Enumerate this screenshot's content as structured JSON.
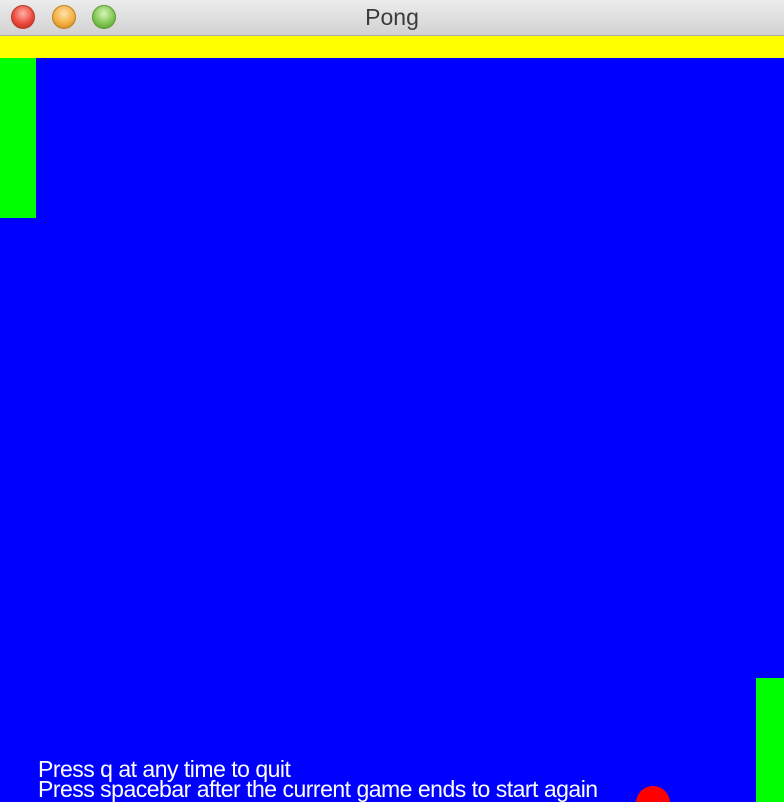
{
  "window": {
    "title": "Pong"
  },
  "game": {
    "instructions": {
      "quit": "Press q  at any time to quit",
      "restart": "Press spacebar after the current game ends to start again"
    },
    "colors": {
      "background": "#0000ff",
      "top_wall": "#ffff00",
      "paddles": "#00ff00",
      "ball": "#ff0000",
      "text": "#ffffff"
    }
  },
  "icons": {
    "close": "close-button-icon",
    "minimize": "minimize-button-icon",
    "zoom": "zoom-button-icon"
  }
}
